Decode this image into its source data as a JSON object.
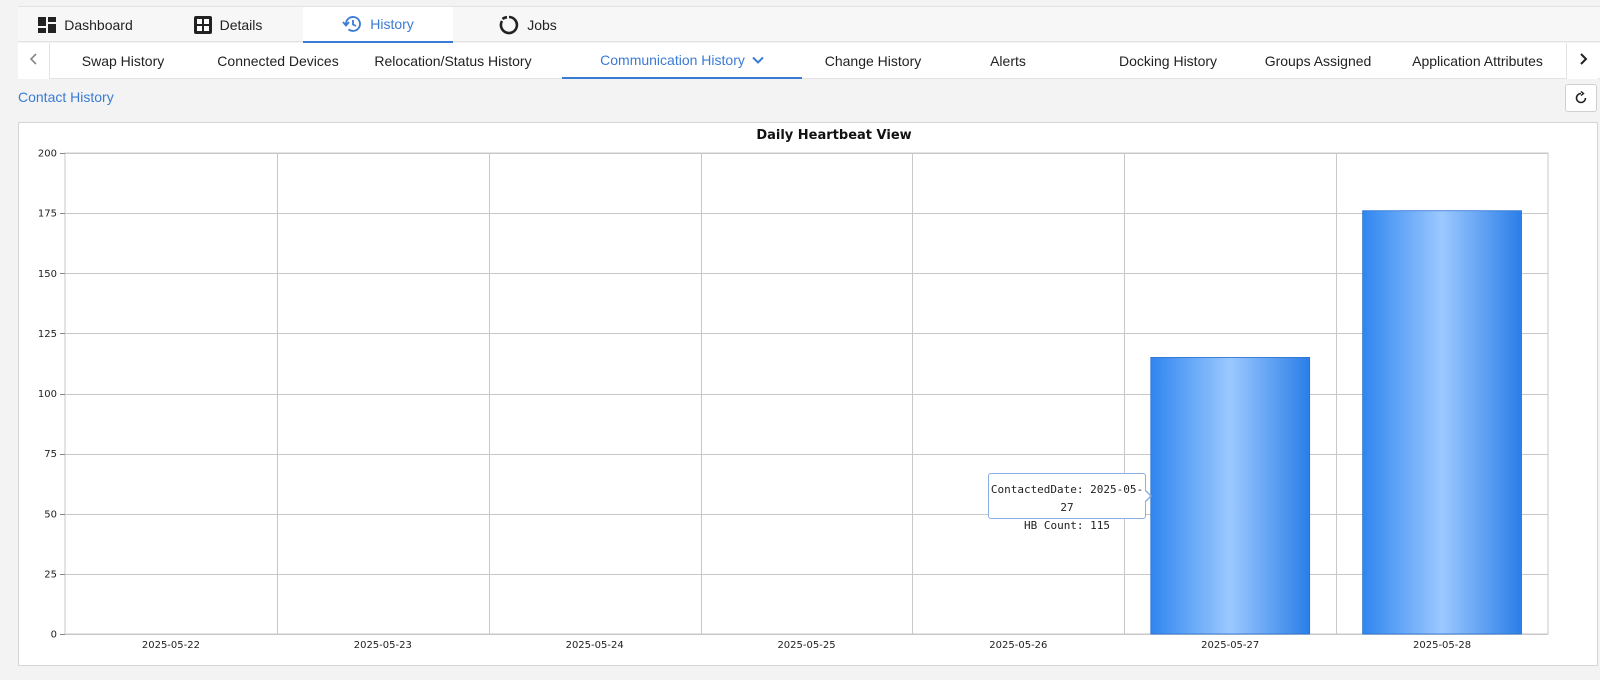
{
  "top_tabs": [
    {
      "label": "Dashboard",
      "icon": "dashboard-icon"
    },
    {
      "label": "Details",
      "icon": "details-icon"
    },
    {
      "label": "History",
      "icon": "history-icon",
      "active": true
    },
    {
      "label": "Jobs",
      "icon": "jobs-icon"
    }
  ],
  "sub_tabs": [
    {
      "label": "Swap History"
    },
    {
      "label": "Connected Devices"
    },
    {
      "label": "Relocation/Status History"
    },
    {
      "label": "Communication History",
      "active": true,
      "dropdown": true
    },
    {
      "label": "Change History"
    },
    {
      "label": "Alerts"
    },
    {
      "label": "Docking History"
    },
    {
      "label": "Groups Assigned"
    },
    {
      "label": "Application Attributes"
    }
  ],
  "section": {
    "title": "Contact History"
  },
  "tooltip": {
    "line1": "ContactedDate: 2025-05-27",
    "line2": "HB Count: 115"
  },
  "colors": {
    "accent": "#3a7bd5",
    "bar": "#2f86f0",
    "bar_highlight": "#9cc8ff"
  },
  "chart_data": {
    "type": "bar",
    "title": "Daily Heartbeat View",
    "categories": [
      "2025-05-22",
      "2025-05-23",
      "2025-05-24",
      "2025-05-25",
      "2025-05-26",
      "2025-05-27",
      "2025-05-28"
    ],
    "values": [
      0,
      0,
      0,
      0,
      0,
      115,
      176
    ],
    "ylim": [
      0,
      200
    ],
    "yticks": [
      0,
      25,
      50,
      75,
      100,
      125,
      150,
      175,
      200
    ],
    "xlabel": "",
    "ylabel": "",
    "grid": true
  }
}
